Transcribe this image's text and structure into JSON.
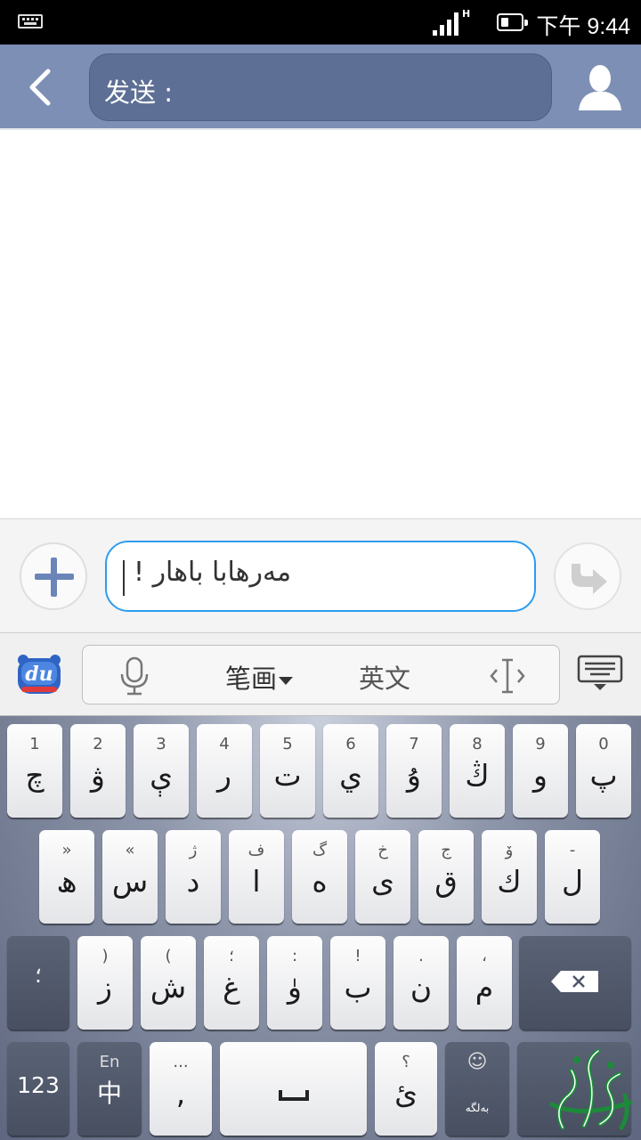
{
  "status_bar": {
    "network": "H",
    "time": "下午 9:44"
  },
  "header": {
    "to_label": "发送 :"
  },
  "compose": {
    "message_value": "مەرھابا باھار !"
  },
  "ime_bar": {
    "stroke_label": "笔画",
    "english_label": "英文"
  },
  "keyboard": {
    "row1": [
      {
        "sec": "1",
        "pri": "چ"
      },
      {
        "sec": "2",
        "pri": "ۋ"
      },
      {
        "sec": "3",
        "pri": "ې"
      },
      {
        "sec": "4",
        "pri": "ر"
      },
      {
        "sec": "5",
        "pri": "ت"
      },
      {
        "sec": "6",
        "pri": "ي"
      },
      {
        "sec": "7",
        "pri": "ۇ"
      },
      {
        "sec": "8",
        "pri": "ڭ"
      },
      {
        "sec": "9",
        "pri": "و"
      },
      {
        "sec": "0",
        "pri": "پ"
      }
    ],
    "row2": [
      {
        "sec": "»",
        "pri": "ھ"
      },
      {
        "sec": "«",
        "pri": "س"
      },
      {
        "sec": "ژ",
        "pri": "د"
      },
      {
        "sec": "ف",
        "pri": "ا"
      },
      {
        "sec": "گ",
        "pri": "ە"
      },
      {
        "sec": "خ",
        "pri": "ى"
      },
      {
        "sec": "ج",
        "pri": "ق"
      },
      {
        "sec": "ۆ",
        "pri": "ك"
      },
      {
        "sec": "-",
        "pri": "ل"
      }
    ],
    "row3": [
      {
        "sec": ")",
        "pri": "ز"
      },
      {
        "sec": "(",
        "pri": "ش"
      },
      {
        "sec": "؛",
        "pri": "غ"
      },
      {
        "sec": ":",
        "pri": "ۈ"
      },
      {
        "sec": "!",
        "pri": "ب"
      },
      {
        "sec": ".",
        "pri": "ن"
      },
      {
        "sec": "،",
        "pri": "م"
      }
    ],
    "shift_label": "؛",
    "numbers_label": "123",
    "lang_sec": "En",
    "lang_pri": "中",
    "punct_sec": "...",
    "punct_pri": ",",
    "question_sec": "؟",
    "question_pri": "ئ",
    "emoji_sec": "☺",
    "emoji_pri": "بەلگە"
  }
}
